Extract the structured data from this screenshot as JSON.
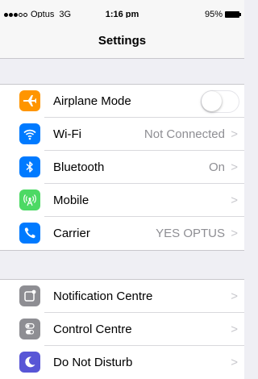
{
  "status_bar": {
    "signal_strength": "3 of 5",
    "carrier": "Optus",
    "network": "3G",
    "time": "1:16 pm",
    "battery_percent": "95%",
    "battery_level": 0.95
  },
  "nav": {
    "title": "Settings"
  },
  "group1": [
    {
      "label": "Airplane Mode",
      "icon": "airplane-icon",
      "color": "#ff9500",
      "toggle": "off"
    },
    {
      "label": "Wi-Fi",
      "detail": "Not Connected",
      "icon": "wifi-icon",
      "color": "#007aff"
    },
    {
      "label": "Bluetooth",
      "detail": "On",
      "icon": "bluetooth-icon",
      "color": "#007aff"
    },
    {
      "label": "Mobile",
      "detail": "",
      "icon": "mobile-signal-icon",
      "color": "#4cd964"
    },
    {
      "label": "Carrier",
      "detail": "YES OPTUS",
      "icon": "phone-icon",
      "color": "#007aff"
    }
  ],
  "group2": [
    {
      "label": "Notification Centre",
      "icon": "notification-icon",
      "color": "#8e8e93"
    },
    {
      "label": "Control Centre",
      "icon": "control-toggles-icon",
      "color": "#8e8e93"
    },
    {
      "label": "Do Not Disturb",
      "icon": "moon-icon",
      "color": "#5856d6"
    }
  ]
}
